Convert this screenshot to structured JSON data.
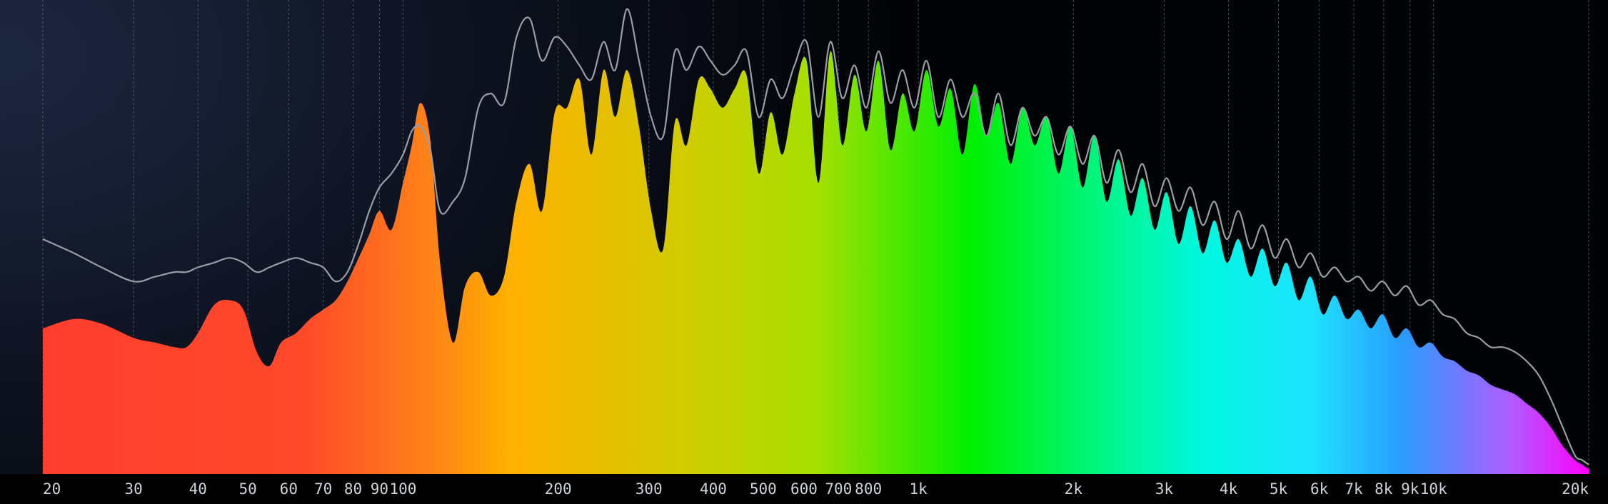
{
  "chart_data": {
    "type": "area",
    "title": "",
    "xlabel": "",
    "ylabel": "",
    "x_scale": "log",
    "xlim": [
      20,
      20000
    ],
    "ylim": [
      0,
      1
    ],
    "grid": true,
    "x_ticks": [
      {
        "value": 20,
        "label": "20"
      },
      {
        "value": 30,
        "label": "30"
      },
      {
        "value": 40,
        "label": "40"
      },
      {
        "value": 50,
        "label": "50"
      },
      {
        "value": 60,
        "label": "60"
      },
      {
        "value": 70,
        "label": "70"
      },
      {
        "value": 80,
        "label": "80"
      },
      {
        "value": 90,
        "label": "90"
      },
      {
        "value": 100,
        "label": "100"
      },
      {
        "value": 200,
        "label": "200"
      },
      {
        "value": 300,
        "label": "300"
      },
      {
        "value": 400,
        "label": "400"
      },
      {
        "value": 500,
        "label": "500"
      },
      {
        "value": 600,
        "label": "600"
      },
      {
        "value": 700,
        "label": "700"
      },
      {
        "value": 800,
        "label": "800"
      },
      {
        "value": 1000,
        "label": "1k"
      },
      {
        "value": 2000,
        "label": "2k"
      },
      {
        "value": 3000,
        "label": "3k"
      },
      {
        "value": 4000,
        "label": "4k"
      },
      {
        "value": 5000,
        "label": "5k"
      },
      {
        "value": 6000,
        "label": "6k"
      },
      {
        "value": 7000,
        "label": "7k"
      },
      {
        "value": 8000,
        "label": "8k"
      },
      {
        "value": 9000,
        "label": "9k"
      },
      {
        "value": 10000,
        "label": "10k"
      },
      {
        "value": 20000,
        "label": "20k"
      }
    ],
    "series": [
      {
        "kind": "filled-spectrum",
        "x": [
          20,
          23,
          26,
          30,
          33,
          36,
          38,
          40,
          43,
          46,
          49,
          52,
          55,
          58,
          62,
          66,
          70,
          74,
          78,
          82,
          86,
          90,
          95,
          100,
          104,
          108,
          113,
          118,
          125,
          132,
          140,
          148,
          157,
          166,
          176,
          186,
          197,
          208,
          220,
          232,
          245,
          258,
          272,
          287,
          303,
          320,
          337,
          355,
          375,
          395,
          417,
          440,
          464,
          490,
          517,
          545,
          575,
          607,
          640,
          675,
          712,
          752,
          793,
          837,
          883,
          932,
          983,
          1037,
          1094,
          1155,
          1218,
          1285,
          1356,
          1431,
          1510,
          1593,
          1681,
          1774,
          1871,
          1974,
          2083,
          2198,
          2319,
          2447,
          2582,
          2724,
          2874,
          3033,
          3200,
          3376,
          3562,
          3759,
          3966,
          4184,
          4415,
          4658,
          4915,
          5186,
          5472,
          5773,
          6091,
          6427,
          6781,
          7155,
          7549,
          7965,
          8404,
          8868,
          9356,
          9872,
          10416,
          10990,
          11596,
          12235,
          12909,
          13620,
          14371,
          15163,
          16000,
          16880,
          17800,
          18800,
          19400,
          20000
        ],
        "y": [
          0.31,
          0.33,
          0.32,
          0.29,
          0.28,
          0.27,
          0.27,
          0.3,
          0.36,
          0.37,
          0.35,
          0.26,
          0.23,
          0.28,
          0.3,
          0.33,
          0.35,
          0.37,
          0.41,
          0.46,
          0.51,
          0.56,
          0.52,
          0.62,
          0.7,
          0.79,
          0.71,
          0.45,
          0.28,
          0.4,
          0.43,
          0.38,
          0.42,
          0.58,
          0.66,
          0.56,
          0.77,
          0.78,
          0.84,
          0.68,
          0.86,
          0.76,
          0.86,
          0.74,
          0.56,
          0.48,
          0.75,
          0.7,
          0.84,
          0.82,
          0.78,
          0.82,
          0.85,
          0.64,
          0.77,
          0.68,
          0.81,
          0.88,
          0.62,
          0.9,
          0.7,
          0.85,
          0.73,
          0.88,
          0.69,
          0.81,
          0.73,
          0.86,
          0.74,
          0.82,
          0.68,
          0.83,
          0.72,
          0.79,
          0.66,
          0.78,
          0.7,
          0.76,
          0.64,
          0.74,
          0.61,
          0.72,
          0.58,
          0.67,
          0.55,
          0.63,
          0.52,
          0.6,
          0.49,
          0.57,
          0.47,
          0.54,
          0.45,
          0.5,
          0.42,
          0.48,
          0.4,
          0.45,
          0.37,
          0.42,
          0.34,
          0.38,
          0.33,
          0.35,
          0.31,
          0.34,
          0.29,
          0.31,
          0.27,
          0.28,
          0.25,
          0.24,
          0.22,
          0.21,
          0.19,
          0.18,
          0.17,
          0.15,
          0.13,
          0.1,
          0.06,
          0.03,
          0.02,
          0.01
        ]
      },
      {
        "kind": "peak-hold-line",
        "color": "#9a9ca6",
        "x": [
          20,
          23,
          26,
          30,
          33,
          36,
          38,
          40,
          43,
          46,
          49,
          52,
          55,
          58,
          62,
          66,
          70,
          74,
          78,
          82,
          86,
          90,
          95,
          100,
          104,
          108,
          113,
          118,
          125,
          132,
          140,
          148,
          157,
          166,
          176,
          186,
          197,
          208,
          220,
          232,
          245,
          258,
          272,
          287,
          303,
          320,
          337,
          355,
          375,
          395,
          417,
          440,
          464,
          490,
          517,
          545,
          575,
          607,
          640,
          675,
          712,
          752,
          793,
          837,
          883,
          932,
          983,
          1037,
          1094,
          1155,
          1218,
          1285,
          1356,
          1431,
          1510,
          1593,
          1681,
          1774,
          1871,
          1974,
          2083,
          2198,
          2319,
          2447,
          2582,
          2724,
          2874,
          3033,
          3200,
          3376,
          3562,
          3759,
          3966,
          4184,
          4415,
          4658,
          4915,
          5186,
          5472,
          5773,
          6091,
          6427,
          6781,
          7155,
          7549,
          7965,
          8404,
          8868,
          9356,
          9872,
          10416,
          10990,
          11596,
          12235,
          12909,
          13620,
          14371,
          15163,
          16000,
          16880,
          17800,
          18800,
          19400,
          20000
        ],
        "y": [
          0.5,
          0.47,
          0.44,
          0.41,
          0.42,
          0.43,
          0.43,
          0.44,
          0.45,
          0.46,
          0.45,
          0.43,
          0.44,
          0.45,
          0.46,
          0.45,
          0.44,
          0.41,
          0.43,
          0.49,
          0.56,
          0.61,
          0.64,
          0.68,
          0.73,
          0.74,
          0.69,
          0.56,
          0.58,
          0.63,
          0.78,
          0.81,
          0.79,
          0.93,
          0.97,
          0.88,
          0.93,
          0.91,
          0.87,
          0.84,
          0.92,
          0.86,
          0.99,
          0.88,
          0.76,
          0.72,
          0.9,
          0.86,
          0.91,
          0.88,
          0.85,
          0.87,
          0.9,
          0.76,
          0.84,
          0.8,
          0.87,
          0.92,
          0.76,
          0.92,
          0.8,
          0.87,
          0.78,
          0.9,
          0.79,
          0.86,
          0.78,
          0.88,
          0.76,
          0.84,
          0.76,
          0.81,
          0.72,
          0.81,
          0.7,
          0.78,
          0.72,
          0.76,
          0.68,
          0.74,
          0.66,
          0.72,
          0.62,
          0.69,
          0.6,
          0.66,
          0.57,
          0.63,
          0.56,
          0.61,
          0.53,
          0.58,
          0.5,
          0.56,
          0.48,
          0.53,
          0.46,
          0.5,
          0.44,
          0.47,
          0.42,
          0.44,
          0.41,
          0.42,
          0.39,
          0.41,
          0.38,
          0.4,
          0.36,
          0.37,
          0.34,
          0.33,
          0.3,
          0.29,
          0.27,
          0.27,
          0.26,
          0.24,
          0.21,
          0.16,
          0.1,
          0.04,
          0.03,
          0.02
        ]
      }
    ],
    "colors": {
      "background_top_left": "#1d2740",
      "background_top_right": "#000000",
      "spectrum_gradient": [
        "#ff3d2e",
        "#ff8a14",
        "#ffb000",
        "#d8c800",
        "#a6e000",
        "#00f000",
        "#00f7d8",
        "#1ee3ff",
        "#2a9cff",
        "#b05bff",
        "#ff00ff"
      ],
      "label": "#cfd3dc",
      "grid": "#7d8698"
    }
  }
}
